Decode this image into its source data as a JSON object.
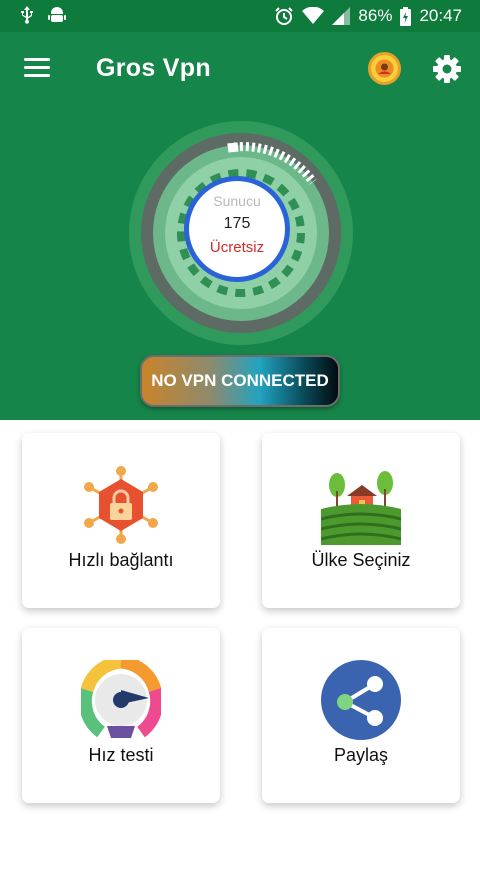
{
  "status_bar": {
    "battery_percent": "86%",
    "time": "20:47",
    "icons": [
      "usb-icon",
      "android-debug-icon",
      "alarm-icon",
      "wifi-icon",
      "signal-icon",
      "battery-icon"
    ]
  },
  "header": {
    "title": "Gros Vpn",
    "bg_color": "#16854a",
    "icons": [
      "menu-icon",
      "vip-icon",
      "gear-icon"
    ]
  },
  "server": {
    "label": "Sunucu",
    "count": "175",
    "type": "Ücretsiz"
  },
  "connection": {
    "status": "NO VPN CONNECTED"
  },
  "menu": {
    "quick_connect": "Hızlı bağlantı",
    "select_country": "Ülke Seçiniz",
    "speed_test": "Hız testi",
    "share": "Paylaş"
  }
}
